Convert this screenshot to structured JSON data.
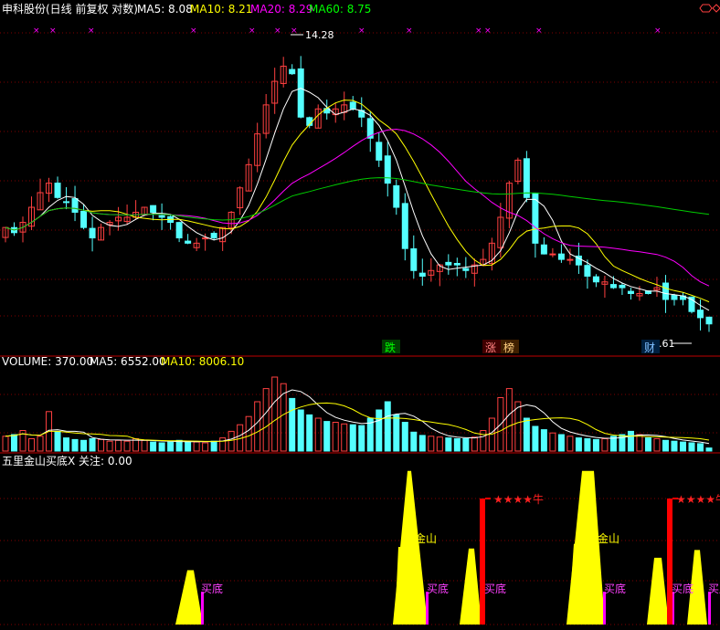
{
  "header": {
    "title": "申科股份(日线 前复权 对数)",
    "ma_labels": [
      "MA5: 8.08",
      "MA10: 8.21",
      "MA20: 8.29",
      "MA60: 8.75"
    ]
  },
  "volume_header": {
    "title": "VOLUME: 370.00",
    "ma_labels": [
      "MA5: 6552.00",
      "MA10: 8006.10"
    ]
  },
  "indicator_header": {
    "title": "五里金山买底X 关注: 0.00"
  },
  "colors": {
    "up": "#ff4040",
    "down": "#54ffff",
    "ma5": "#ffffff",
    "ma10": "#ffff00",
    "ma20": "#ff00ff",
    "ma60": "#00cc00",
    "grid": "#800000",
    "yellow_area": "#ffff00",
    "red_bar": "#ff0000",
    "magenta": "#ff00ff"
  },
  "annotations": {
    "high_label": "14.28",
    "low_label": "7.61",
    "event_tags": [
      "跌",
      "涨",
      "榜",
      "财"
    ],
    "area_labels": [
      "买底",
      "金山",
      "买底",
      "买底",
      "金山",
      "买底",
      "买底",
      "买底"
    ],
    "star_labels": [
      "★★★★牛",
      "★★★★牛"
    ],
    "x_marks": [
      "××",
      "××",
      "×",
      "×",
      "××",
      "×",
      "×",
      "×",
      "×",
      "×",
      "×",
      "×",
      "×",
      "×"
    ]
  },
  "chart_data": [
    {
      "type": "candlestick",
      "title": "申科股份(日线 前复权 对数)",
      "series_note": "daily OHLC, estimated from price panel",
      "price_range": [
        7.61,
        14.28
      ],
      "high": 14.28,
      "low": 7.61,
      "closes": [
        9.6,
        9.5,
        9.7,
        10.0,
        10.3,
        10.5,
        10.2,
        10.1,
        9.9,
        9.6,
        9.4,
        9.6,
        9.7,
        9.8,
        9.8,
        9.9,
        10.0,
        9.9,
        9.8,
        9.7,
        9.4,
        9.3,
        9.3,
        9.4,
        9.4,
        9.6,
        9.9,
        10.4,
        10.9,
        11.6,
        12.3,
        12.9,
        13.3,
        13.1,
        12.0,
        11.8,
        12.2,
        12.1,
        12.2,
        12.3,
        12.2,
        12.0,
        11.5,
        11.0,
        10.5,
        10.0,
        9.2,
        8.8,
        8.7,
        8.8,
        8.9,
        8.9,
        8.9,
        8.8,
        8.9,
        9.0,
        9.3,
        9.8,
        10.5,
        11.0,
        10.2,
        9.3,
        9.1,
        9.1,
        9.0,
        9.0,
        8.9,
        8.7,
        8.6,
        8.6,
        8.5,
        8.5,
        8.4,
        8.4,
        8.4,
        8.5,
        8.3,
        8.3,
        8.3,
        8.1,
        8.0,
        7.9
      ],
      "ma_last": {
        "MA5": 8.08,
        "MA10": 8.21,
        "MA20": 8.29,
        "MA60": 8.75
      }
    },
    {
      "type": "bar",
      "title": "VOLUME",
      "last": 370.0,
      "ma_last": {
        "MA5": 6552.0,
        "MA10": 8006.1
      },
      "values": [
        1800,
        2000,
        2500,
        1500,
        1800,
        4800,
        2400,
        1600,
        1400,
        1300,
        1500,
        1400,
        1200,
        1300,
        1200,
        1500,
        1300,
        1100,
        1000,
        1100,
        1300,
        1200,
        1100,
        1000,
        1200,
        1600,
        2400,
        3200,
        4200,
        6000,
        7600,
        9000,
        8200,
        6400,
        5000,
        4400,
        4000,
        3600,
        3500,
        3300,
        3200,
        3100,
        4000,
        5000,
        6000,
        4400,
        3500,
        2300,
        1900,
        1800,
        1700,
        1600,
        1500,
        1500,
        1700,
        2500,
        4000,
        6500,
        7600,
        6000,
        4000,
        3000,
        2600,
        2200,
        2000,
        1800,
        1600,
        1500,
        1400,
        1500,
        1800,
        2000,
        2400,
        2000,
        1600,
        1500,
        1300,
        1200,
        1100,
        1000,
        900,
        370
      ]
    },
    {
      "type": "area",
      "title": "五里金山买底X",
      "last": 0.0,
      "peaks": [
        {
          "label": "买底",
          "level": 0.25
        },
        {
          "label": "金山",
          "level": 0.66
        },
        {
          "label": "买底",
          "level": 0.33
        },
        {
          "label": "金山",
          "level": 0.66
        },
        {
          "label": "买底",
          "level": 0.3
        },
        {
          "label": "买底",
          "level": 0.32
        }
      ],
      "signals": [
        "★★★★牛",
        "★★★★牛"
      ]
    }
  ]
}
